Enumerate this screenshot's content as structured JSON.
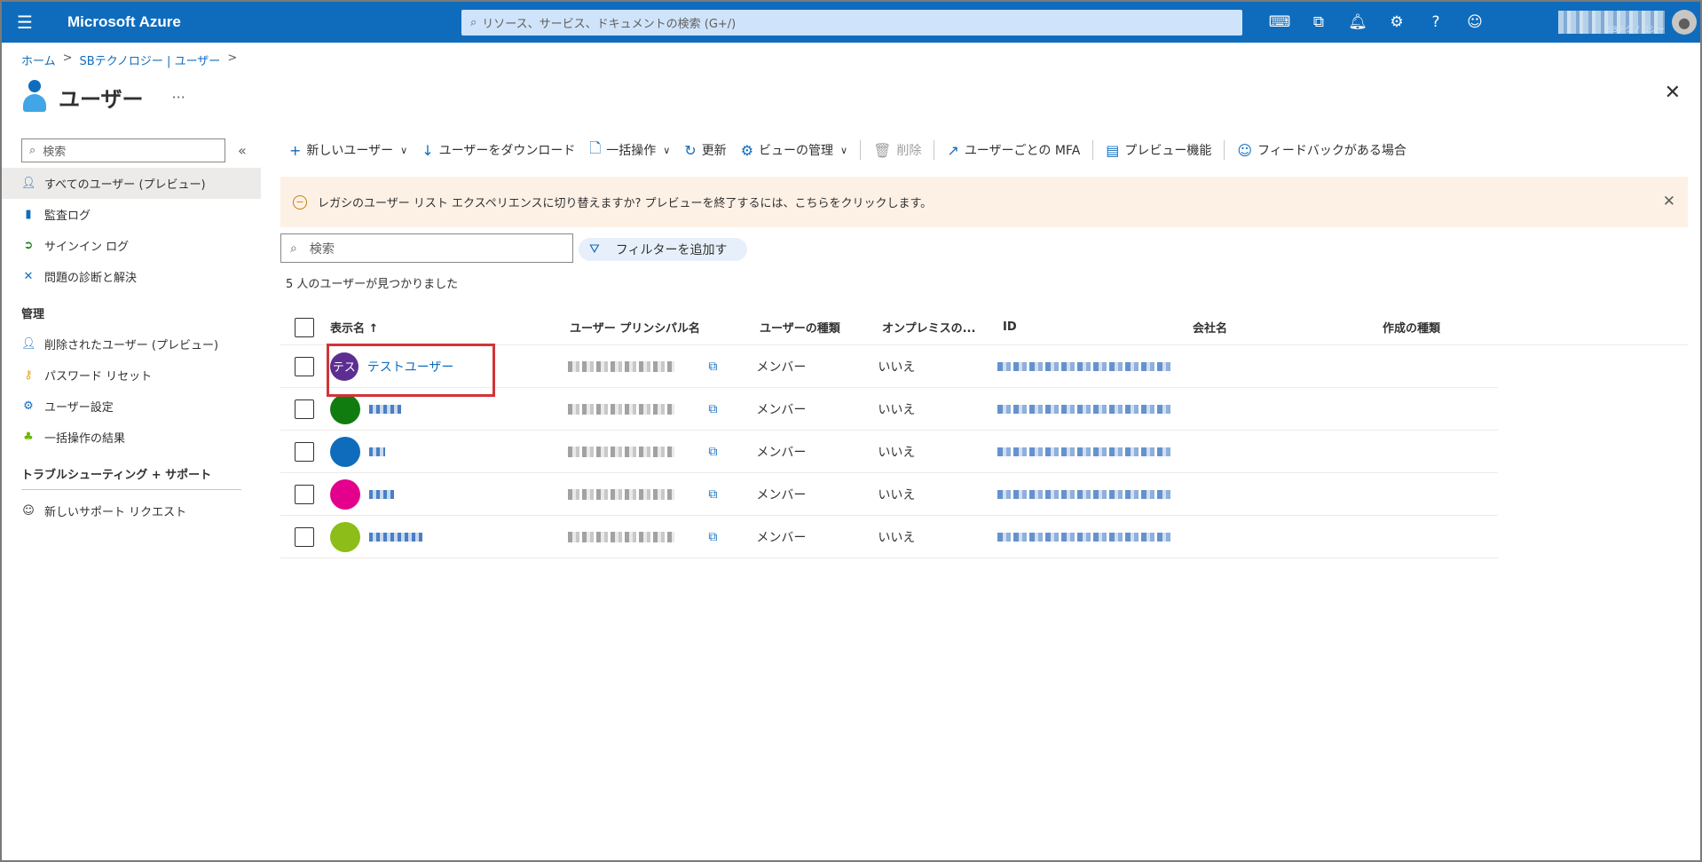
{
  "topbar": {
    "brand": "Microsoft Azure",
    "search_placeholder": "リソース、サービス、ドキュメントの検索 (G+/)",
    "account_tenant": "SBテクノロジー"
  },
  "breadcrumb": [
    "ホーム",
    "SBテクノロジー | ユーザー"
  ],
  "page": {
    "title": "ユーザー",
    "more": "···"
  },
  "sidebar": {
    "search_placeholder": "検索",
    "items": [
      {
        "label": "すべてのユーザー (プレビュー)",
        "icon": "user-icon",
        "active": true
      },
      {
        "label": "監査ログ",
        "icon": "log-book-icon"
      },
      {
        "label": "サインイン ログ",
        "icon": "signin-icon"
      },
      {
        "label": "問題の診断と解決",
        "icon": "wrench-icon"
      }
    ],
    "group_manage": "管理",
    "manage_items": [
      {
        "label": "削除されたユーザー (プレビュー)",
        "icon": "deleted-user-icon"
      },
      {
        "label": "パスワード リセット",
        "icon": "key-icon"
      },
      {
        "label": "ユーザー設定",
        "icon": "user-settings-icon"
      },
      {
        "label": "一括操作の結果",
        "icon": "bulk-results-icon"
      }
    ],
    "group_support": "トラブルシューティング + サポート",
    "support_items": [
      {
        "label": "新しいサポート リクエスト",
        "icon": "support-icon"
      }
    ]
  },
  "toolbar": {
    "new_user": "新しいユーザー",
    "download": "ユーザーをダウンロード",
    "bulk": "一括操作",
    "refresh": "更新",
    "manage_view": "ビューの管理",
    "delete": "削除",
    "per_user_mfa": "ユーザーごとの MFA",
    "preview": "プレビュー機能",
    "feedback": "フィードバックがある場合"
  },
  "banner": {
    "text": "レガシのユーザー リスト エクスペリエンスに切り替えますか? プレビューを終了するには、こちらをクリックします。"
  },
  "list": {
    "search_placeholder": "検索",
    "filter_label": "フィルターを追加す",
    "count": "5 人のユーザーが見つかりました",
    "columns": [
      "表示名 ↑",
      "ユーザー プリンシパル名",
      "ユーザーの種類",
      "オンプレミスの...",
      "ID",
      "会社名",
      "作成の種類"
    ],
    "rows": [
      {
        "avatar_text": "テス",
        "avatar_color": "#5c2e91",
        "name": "テストユーザー",
        "type": "メンバー",
        "onprem": "いいえ"
      },
      {
        "avatar_text": "",
        "avatar_color": "#107c10",
        "name": "",
        "type": "メンバー",
        "onprem": "いいえ"
      },
      {
        "avatar_text": "",
        "avatar_color": "#0f6cbd",
        "name": "",
        "type": "メンバー",
        "onprem": "いいえ"
      },
      {
        "avatar_text": "",
        "avatar_color": "#e3008c",
        "name": "",
        "type": "メンバー",
        "onprem": "いいえ"
      },
      {
        "avatar_text": "",
        "avatar_color": "#8cbd18",
        "name": "",
        "type": "メンバー",
        "onprem": "いいえ"
      }
    ]
  }
}
